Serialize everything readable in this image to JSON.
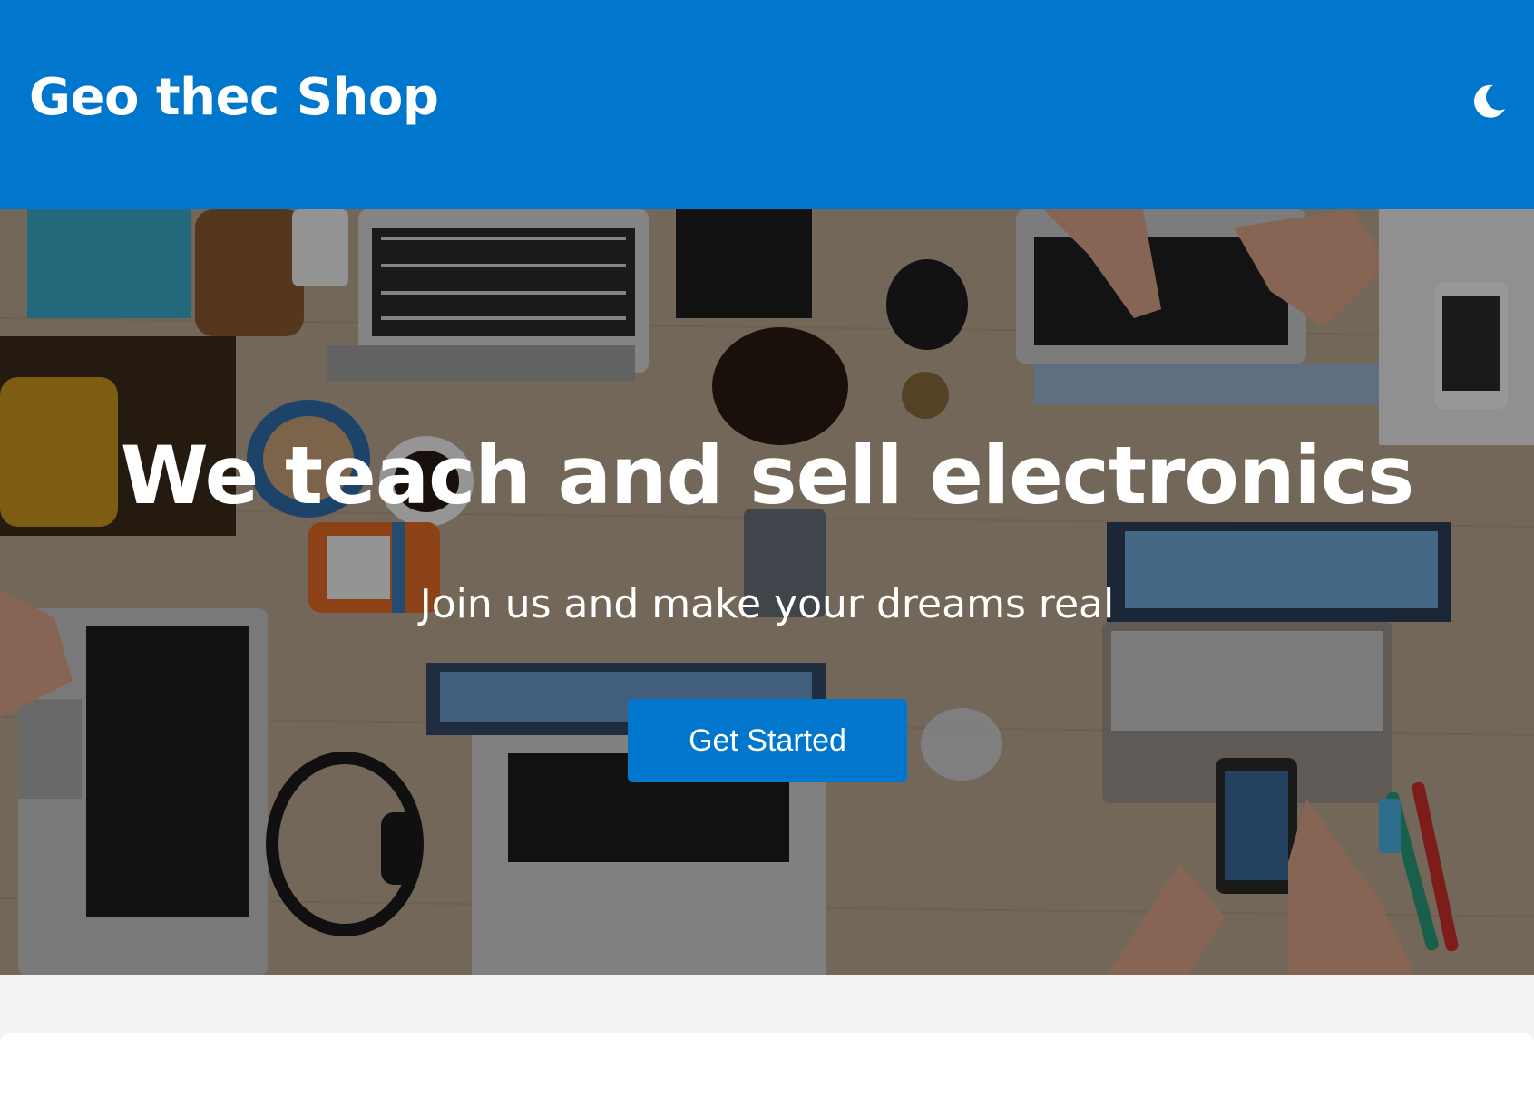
{
  "header": {
    "brand": "Geo thec Shop",
    "theme_toggle_icon": "moon-icon",
    "background": "#0077cc"
  },
  "hero": {
    "title": "We teach and sell electronics",
    "subtitle": "Join us and make your dreams real",
    "cta_label": "Get Started",
    "background_image": "desk-with-laptops-photo"
  },
  "colors": {
    "accent": "#0077cc",
    "page_background": "#f3f3f3",
    "text_on_accent": "#ffffff"
  }
}
